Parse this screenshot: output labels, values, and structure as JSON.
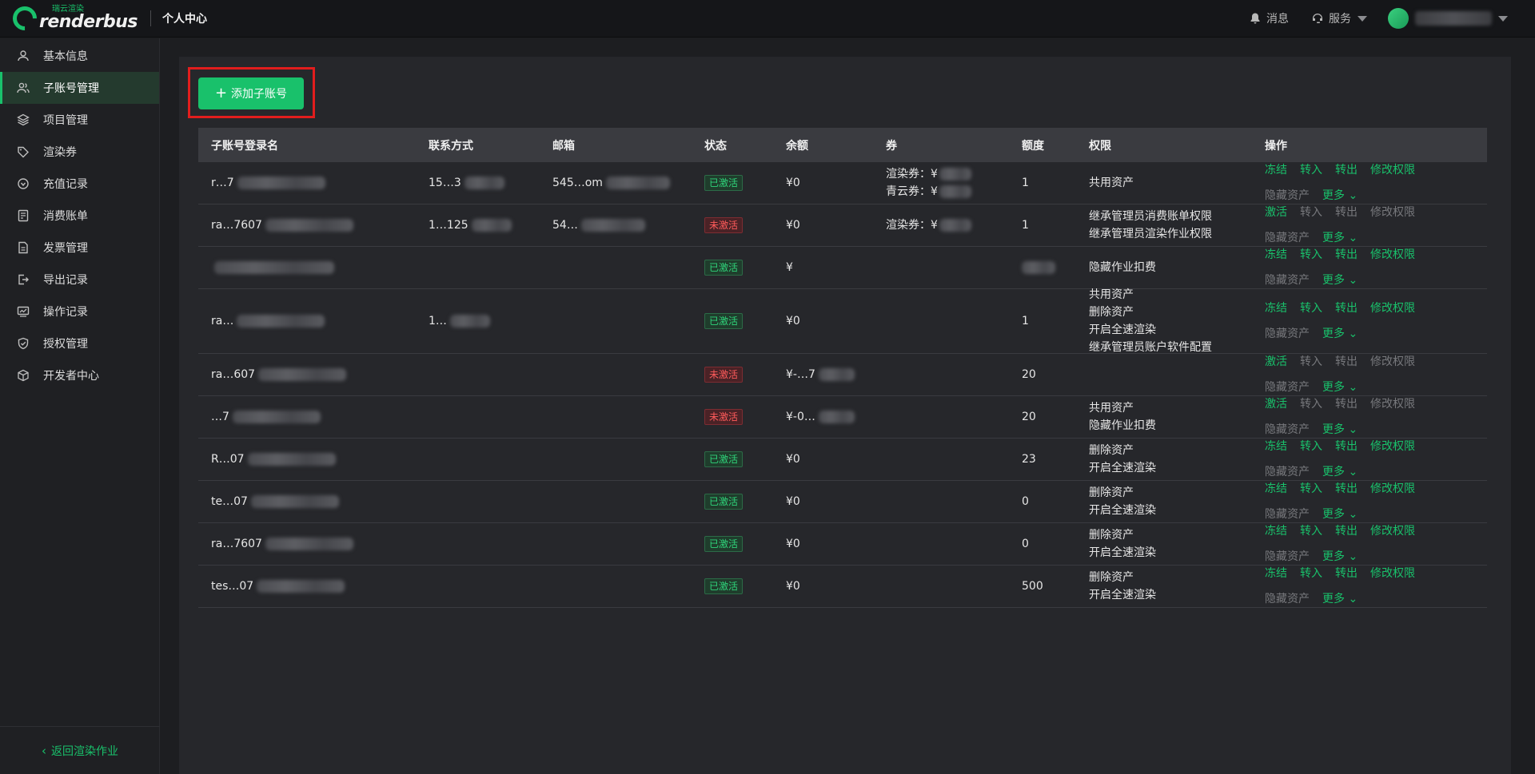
{
  "header": {
    "logo_sub": "瑞云渲染",
    "logo_main": "renderbus",
    "page_title": "个人中心",
    "messages": "消息",
    "service": "服务"
  },
  "sidebar": {
    "items": [
      {
        "label": "基本信息",
        "icon": "user-icon"
      },
      {
        "label": "子账号管理",
        "icon": "users-icon"
      },
      {
        "label": "项目管理",
        "icon": "layers-icon"
      },
      {
        "label": "渲染券",
        "icon": "tag-icon"
      },
      {
        "label": "充值记录",
        "icon": "recharge-icon"
      },
      {
        "label": "消费账单",
        "icon": "bill-icon"
      },
      {
        "label": "发票管理",
        "icon": "invoice-icon"
      },
      {
        "label": "导出记录",
        "icon": "export-icon"
      },
      {
        "label": "操作记录",
        "icon": "chart-icon"
      },
      {
        "label": "授权管理",
        "icon": "shield-icon"
      },
      {
        "label": "开发者中心",
        "icon": "cube-icon"
      }
    ],
    "active_index": 1,
    "back_label": "返回渲染作业"
  },
  "main": {
    "add_button": "添加子账号",
    "columns": [
      "子账号登录名",
      "联系方式",
      "邮箱",
      "状态",
      "余额",
      "券",
      "额度",
      "权限",
      "操作"
    ],
    "rows": [
      {
        "login": "r…7",
        "phone": "15…3",
        "email": "545…om",
        "status": "已激活",
        "active": true,
        "balance": "¥0",
        "coupons": [
          "渲染券：¥",
          "青云券：¥"
        ],
        "quota": "1",
        "perms": [
          "共用资产"
        ],
        "ops_row1": [
          "冻结",
          "转入",
          "转出",
          "修改权限"
        ],
        "ops_row2": "隐藏资产",
        "ops_enabled": true
      },
      {
        "login": "ra…7607",
        "phone": "1…125",
        "email": "54…",
        "status": "未激活",
        "active": false,
        "balance": "¥0",
        "coupons": [
          "渲染券：¥"
        ],
        "quota": "1",
        "perms": [
          "继承管理员消费账单权限",
          "继承管理员渲染作业权限"
        ],
        "ops_row1": [
          "激活",
          "转入",
          "转出",
          "修改权限"
        ],
        "ops_row2": "隐藏资产",
        "ops_enabled": false
      },
      {
        "login": "",
        "phone": "",
        "email": "",
        "status": "已激活",
        "active": true,
        "balance": "¥",
        "coupons": [],
        "quota": "",
        "perms": [
          "隐藏作业扣费"
        ],
        "ops_row1": [
          "冻结",
          "转入",
          "转出",
          "修改权限"
        ],
        "ops_row2": "隐藏资产",
        "ops_enabled": true
      },
      {
        "login": "ra…",
        "phone": "1…",
        "email": "",
        "status": "已激活",
        "active": true,
        "balance": "¥0",
        "coupons": [],
        "quota": "1",
        "perms": [
          "共用资产",
          "删除资产",
          "开启全速渲染",
          "继承管理员账户软件配置"
        ],
        "ops_row1": [
          "冻结",
          "转入",
          "转出",
          "修改权限"
        ],
        "ops_row2": "隐藏资产",
        "ops_enabled": true
      },
      {
        "login": "ra…607",
        "phone": "",
        "email": "",
        "status": "未激活",
        "active": false,
        "balance": "¥-…7",
        "coupons": [],
        "quota": "20",
        "perms": [],
        "ops_row1": [
          "激活",
          "转入",
          "转出",
          "修改权限"
        ],
        "ops_row2": "隐藏资产",
        "ops_enabled": false
      },
      {
        "login": "…7",
        "phone": "",
        "email": "",
        "status": "未激活",
        "active": false,
        "balance": "¥-0…",
        "coupons": [],
        "quota": "20",
        "perms": [
          "共用资产",
          "隐藏作业扣费"
        ],
        "ops_row1": [
          "激活",
          "转入",
          "转出",
          "修改权限"
        ],
        "ops_row2": "隐藏资产",
        "ops_enabled": false
      },
      {
        "login": "R…07",
        "phone": "",
        "email": "",
        "status": "已激活",
        "active": true,
        "balance": "¥0",
        "coupons": [],
        "quota": "23",
        "perms": [
          "删除资产",
          "开启全速渲染"
        ],
        "ops_row1": [
          "冻结",
          "转入",
          "转出",
          "修改权限"
        ],
        "ops_row2": "隐藏资产",
        "ops_enabled": true
      },
      {
        "login": "te…07",
        "phone": "",
        "email": "",
        "status": "已激活",
        "active": true,
        "balance": "¥0",
        "coupons": [],
        "quota": "0",
        "perms": [
          "删除资产",
          "开启全速渲染"
        ],
        "ops_row1": [
          "冻结",
          "转入",
          "转出",
          "修改权限"
        ],
        "ops_row2": "隐藏资产",
        "ops_enabled": true
      },
      {
        "login": "ra…7607",
        "phone": "",
        "email": "",
        "status": "已激活",
        "active": true,
        "balance": "¥0",
        "coupons": [],
        "quota": "0",
        "perms": [
          "删除资产",
          "开启全速渲染"
        ],
        "ops_row1": [
          "冻结",
          "转入",
          "转出",
          "修改权限"
        ],
        "ops_row2": "隐藏资产",
        "ops_enabled": true
      },
      {
        "login": "tes…07",
        "phone": "",
        "email": "",
        "status": "已激活",
        "active": true,
        "balance": "¥0",
        "coupons": [],
        "quota": "500",
        "perms": [
          "删除资产",
          "开启全速渲染"
        ],
        "ops_row1": [
          "冻结",
          "转入",
          "转出",
          "修改权限"
        ],
        "ops_row2": "隐藏资产",
        "ops_enabled": true
      }
    ],
    "more_label": "更多"
  },
  "colors": {
    "accent": "#19c16b",
    "highlight_box": "#e11d1d",
    "inactive_badge": "#ff5b5b"
  }
}
